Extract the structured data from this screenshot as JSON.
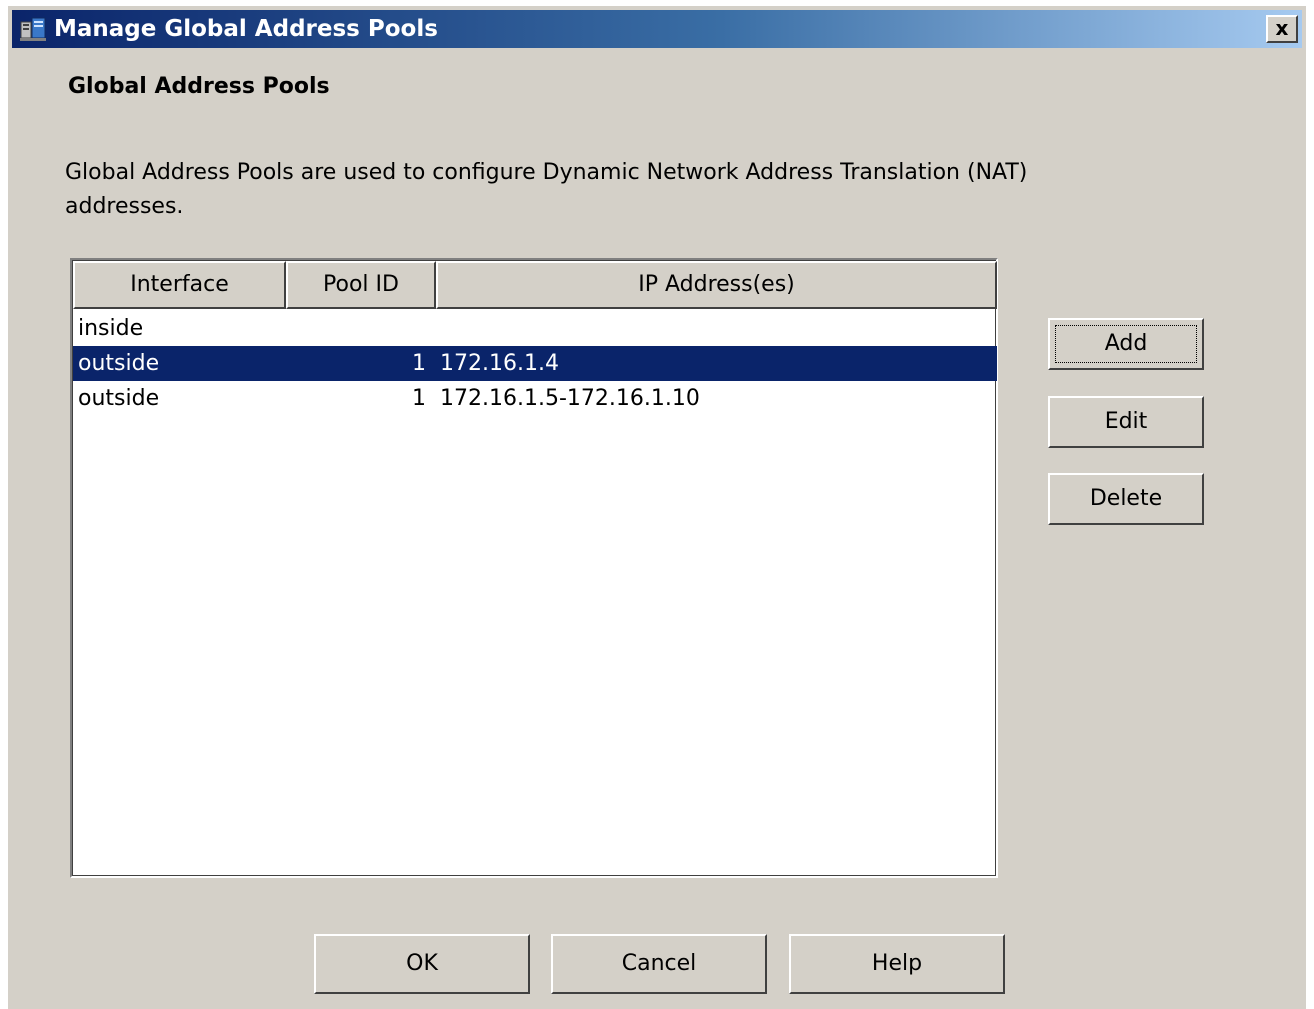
{
  "window": {
    "title": "Manage Global Address Pools",
    "close_label": "x",
    "titlebar_colors": [
      "#0a246a",
      "#3a6ea5",
      "#a6caf0"
    ],
    "background": "#d4d0c8"
  },
  "section": {
    "title": "Global Address Pools",
    "description": "Global Address Pools are used to configure Dynamic Network Address Translation (NAT) addresses."
  },
  "table": {
    "columns": [
      "Interface",
      "Pool ID",
      "IP Address(es)"
    ],
    "rows": [
      {
        "interface": "inside",
        "pool_id": "",
        "ip": "",
        "selected": false
      },
      {
        "interface": "outside",
        "pool_id": "1",
        "ip": "172.16.1.4",
        "selected": true
      },
      {
        "interface": "outside",
        "pool_id": "1",
        "ip": "172.16.1.5-172.16.1.10",
        "selected": false
      }
    ],
    "selection_color": "#0a246a"
  },
  "side_buttons": {
    "add": "Add",
    "edit": "Edit",
    "delete": "Delete"
  },
  "bottom_buttons": {
    "ok": "OK",
    "cancel": "Cancel",
    "help": "Help"
  }
}
